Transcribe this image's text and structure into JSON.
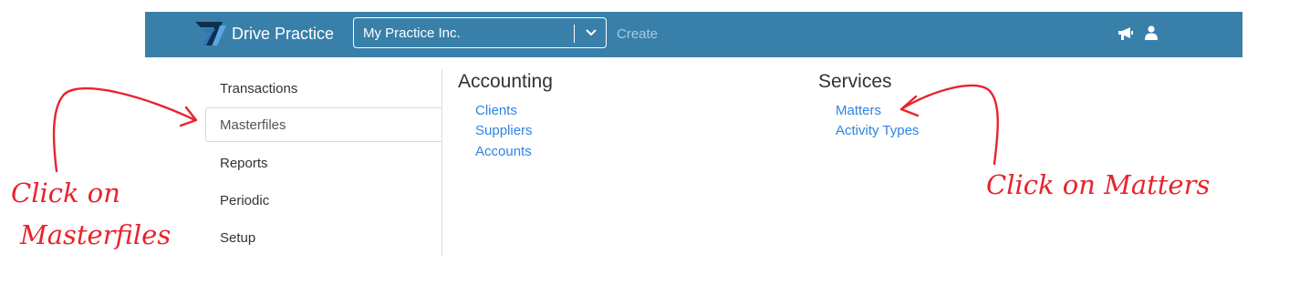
{
  "header": {
    "brand": "Drive Practice",
    "practice_select": {
      "value": "My Practice Inc."
    },
    "create_label": "Create",
    "icons": [
      "logo-icon",
      "megaphone-icon",
      "user-icon",
      "chevron-down-icon"
    ],
    "bar_color": "#3880aa"
  },
  "menu": {
    "items": [
      {
        "label": "Transactions",
        "active": false
      },
      {
        "label": "Masterfiles",
        "active": true
      },
      {
        "label": "Reports",
        "active": false
      },
      {
        "label": "Periodic",
        "active": false
      },
      {
        "label": "Setup",
        "active": false
      }
    ]
  },
  "content": {
    "accounting": {
      "title": "Accounting",
      "links": [
        "Clients",
        "Suppliers",
        "Accounts"
      ]
    },
    "services": {
      "title": "Services",
      "links": [
        "Matters",
        "Activity Types"
      ]
    },
    "link_color": "#2d84e0"
  },
  "annotations": {
    "left_line1": "Click on",
    "left_line2": "Masterfiles",
    "right": "Click on Matters",
    "color": "#e8232d"
  }
}
